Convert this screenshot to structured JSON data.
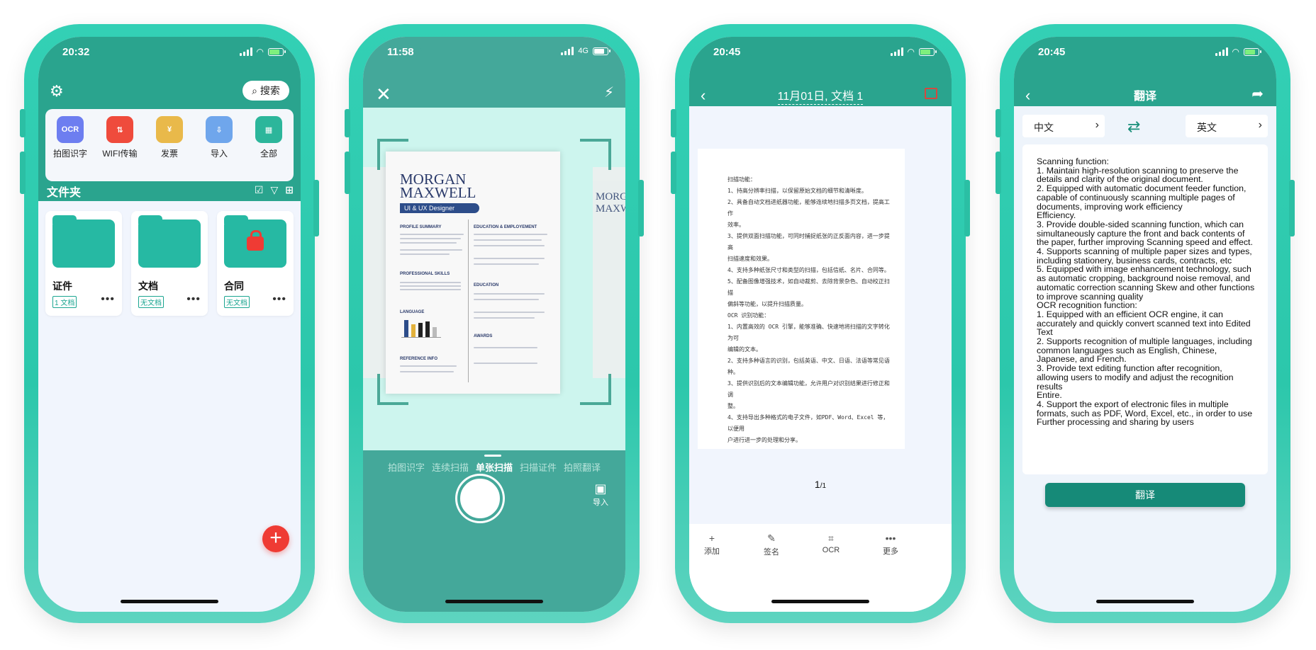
{
  "phone1": {
    "time": "20:32",
    "search_label": "搜索",
    "quick_items": [
      {
        "label": "拍图识字",
        "icon": "OCR",
        "color": "#6d7ef0"
      },
      {
        "label": "WIFI传输",
        "icon": "⇅",
        "color": "#ef4b3c"
      },
      {
        "label": "发票",
        "icon": "¥",
        "color": "#e9b94a"
      },
      {
        "label": "导入",
        "icon": "⇩",
        "color": "#6fa6ec"
      },
      {
        "label": "全部",
        "icon": "▦",
        "color": "#2cb69b"
      }
    ],
    "folder_section_title": "文件夹",
    "folders": [
      {
        "name": "证件",
        "badge": "1 文档"
      },
      {
        "name": "文档",
        "badge": "无文档"
      },
      {
        "name": "合同",
        "badge": "无文档"
      }
    ],
    "more_glyph": "•••",
    "fab": "+"
  },
  "phone2": {
    "time": "11:58",
    "network": "4G",
    "close_glyph": "✕",
    "flash_glyph": "⚡",
    "doc": {
      "name_line1": "MORGAN",
      "name_line2": "MAXWELL",
      "role": "UI & UX Designer",
      "h_profile": "PROFILE SUMMARY",
      "h_skills": "PROFESSIONAL SKILLS",
      "h_language": "LANGUAGE",
      "h_reference": "REFERENCE INFO",
      "h_education_emp": "EDUCATION & EMPLOYEMENT",
      "h_education": "EDUCATION",
      "h_awards": "AWARDS",
      "side_left": "MORG",
      "side_left2": "MAXW"
    },
    "modes": [
      "拍图识字",
      "连续扫描",
      "单张扫描",
      "扫描证件",
      "拍照翻译"
    ],
    "active_mode": "单张扫描",
    "import_label": "导入"
  },
  "phone3": {
    "time": "20:45",
    "title": "11月01日, 文档 1",
    "doc_lines": [
      "扫描功能：",
      "1、持高分辨率扫描，以保留原始文档的细节和清晰度。",
      "2、具备自动文档进纸器功能，能够连续地扫描多页文档，提高工作",
      "效率。",
      "3、提供双面扫描功能，可同时捕捉纸张的正反面内容，进一步提高",
      "扫描速度和效果。",
      "4、支持多种纸张尺寸和类型的扫描，包括信纸、名片、合同等。",
      "5、配备图像增强技术，如自动裁剪、去除背景杂色、自动校正扫描",
      "偏斜等功能，以提升扫描质量。",
      "OCR 识别功能：",
      "1、内置高效的 OCR 引擎，能够准确、快速地将扫描的文字转化为可",
      "编辑的文本。",
      "2、支持多种语言的识别，包括英语、中文、日语、法语等常见语种。",
      "3、提供识别后的文本编辑功能，允许用户对识别结果进行修正和调",
      "整。",
      "4、支持导出多种格式的电子文件，如PDF、Word、Excel 等，以便用",
      "户进行进一步的处理和分享。"
    ],
    "page_current": "1",
    "page_total": "/1",
    "toolbar": [
      {
        "label": "添加",
        "icon": "+"
      },
      {
        "label": "签名",
        "icon": "✎"
      },
      {
        "label": "OCR",
        "icon": "⌗"
      },
      {
        "label": "更多",
        "icon": "•••"
      }
    ]
  },
  "phone4": {
    "time": "20:45",
    "title": "翻译",
    "source_lang": "中文",
    "target_lang": "英文",
    "translated_text": "Scanning function:\n1. Maintain high-resolution scanning to preserve the details and clarity of the original document.\n2. Equipped with automatic document feeder function, capable of continuously scanning multiple pages of documents, improving work efficiency\nEfficiency.\n3. Provide double-sided scanning function, which can simultaneously capture the front and back contents of the paper, further improving Scanning speed and effect.\n4. Supports scanning of multiple paper sizes and types, including stationery, business cards, contracts, etc\n5. Equipped with image enhancement technology, such as automatic cropping, background noise removal, and automatic correction scanning Skew and other functions to improve scanning quality\nOCR recognition function:\n1. Equipped with an efficient OCR engine, it can accurately and quickly convert scanned text into Edited Text\n2. Supports recognition of multiple languages, including common languages such as English, Chinese, Japanese, and French.\n3. Provide text editing function after recognition, allowing users to modify and adjust the recognition results\nEntire.\n4. Support the export of electronic files in multiple formats, such as PDF, Word, Excel, etc., in order to use\nFurther processing and sharing by users",
    "translate_button": "翻译"
  },
  "colors": {
    "phone_frame": "#2cc7ab",
    "header_teal": "#2aa48e",
    "camera_teal": "#44a89a",
    "accent_red": "#ef3b34"
  }
}
